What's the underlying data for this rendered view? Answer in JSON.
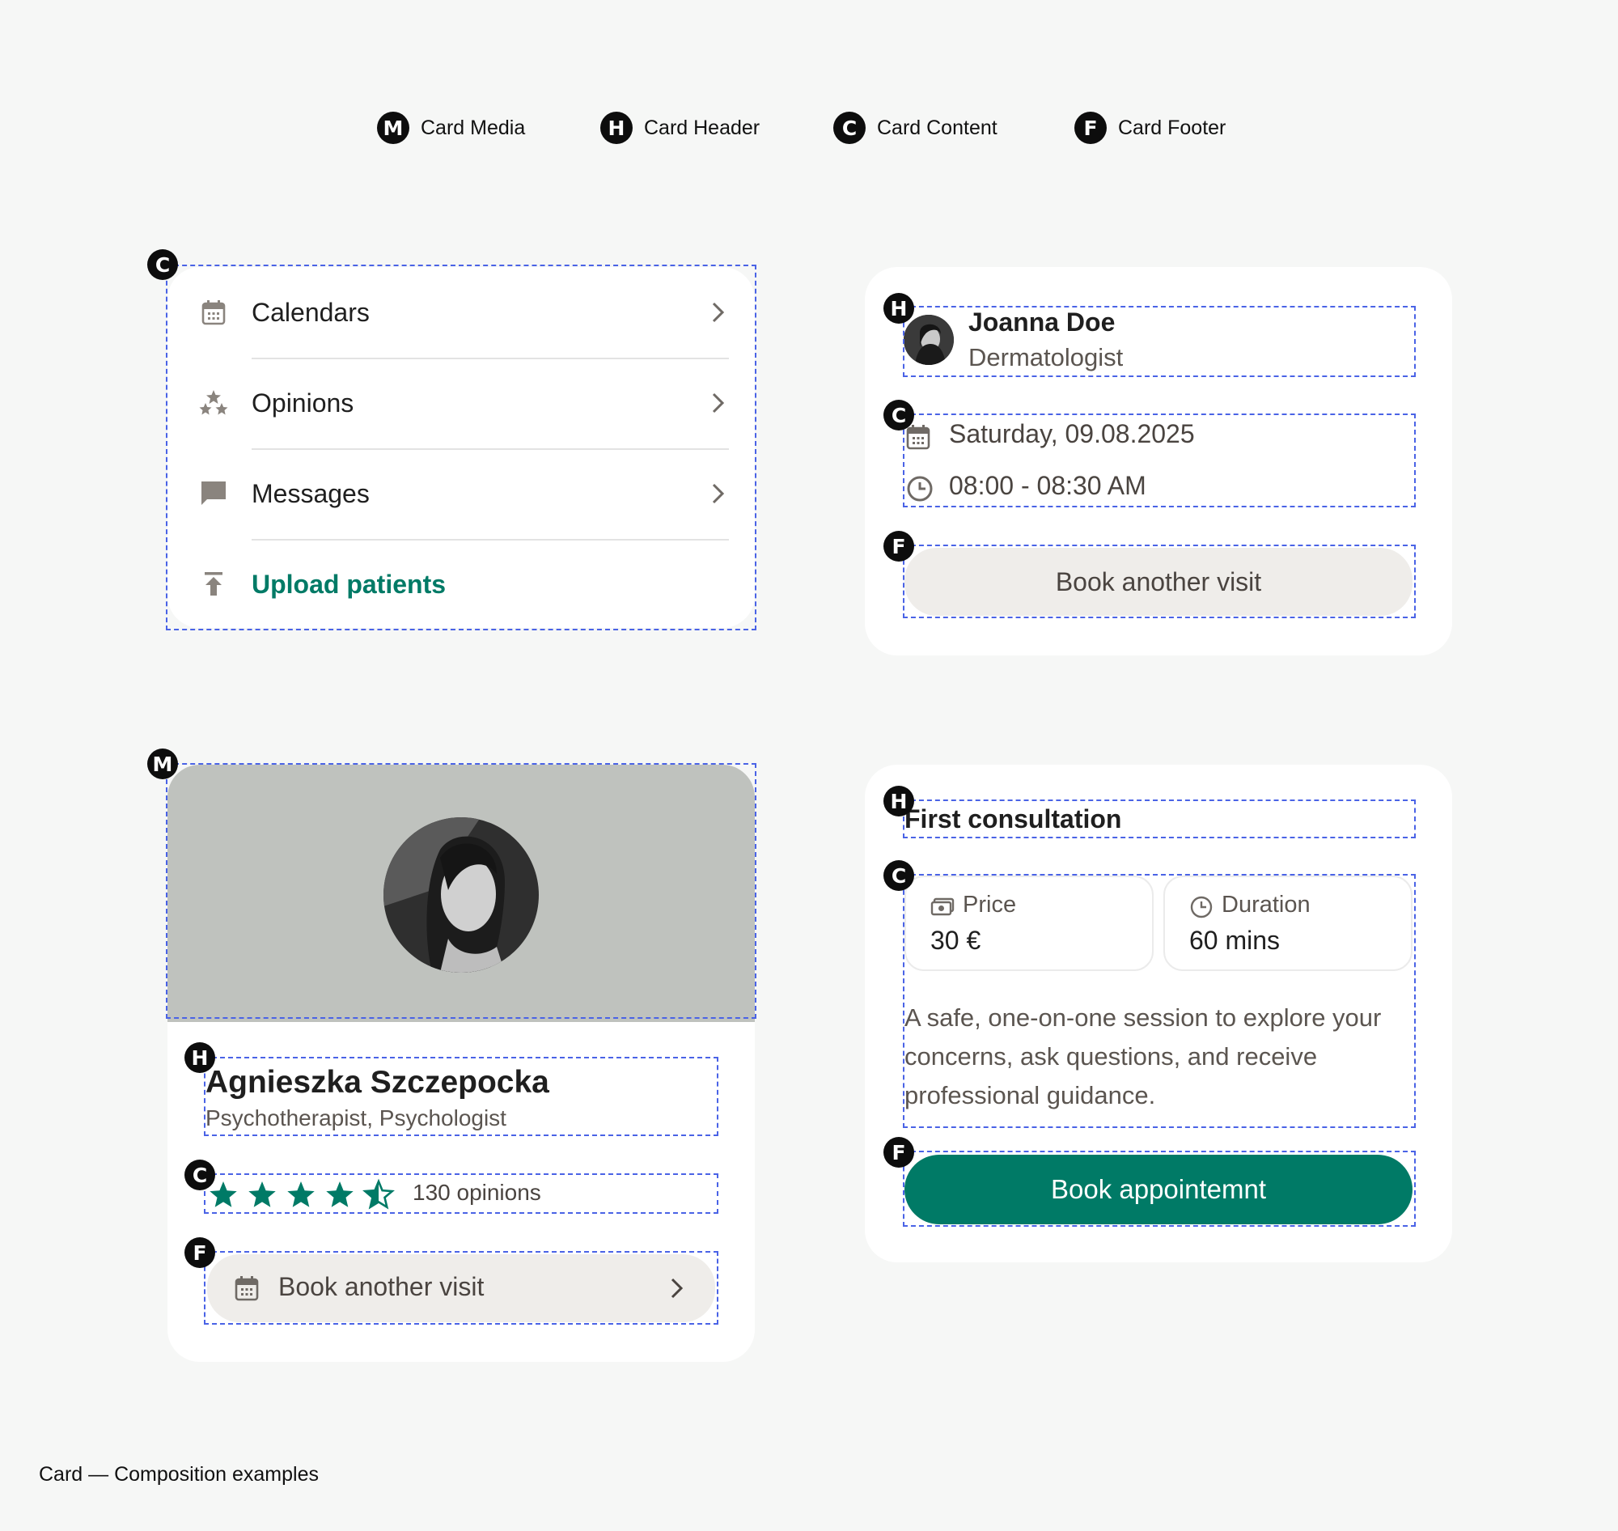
{
  "legend": {
    "items": [
      {
        "badge": "M",
        "label": "Card Media"
      },
      {
        "badge": "H",
        "label": "Card Header"
      },
      {
        "badge": "C",
        "label": "Card Content"
      },
      {
        "badge": "F",
        "label": "Card Footer"
      }
    ]
  },
  "menu_card": {
    "badge": "C",
    "items": [
      {
        "label": "Calendars",
        "icon": "calendar-icon"
      },
      {
        "label": "Opinions",
        "icon": "stars-icon"
      },
      {
        "label": "Messages",
        "icon": "message-icon"
      }
    ],
    "upload": {
      "label": "Upload patients",
      "icon": "upload-icon"
    }
  },
  "appointment_card": {
    "header_badge": "H",
    "name": "Joanna Doe",
    "role": "Dermatologist",
    "content_badge": "C",
    "date": "Saturday, 09.08.2025",
    "time": "08:00 - 08:30 AM",
    "footer_badge": "F",
    "button": "Book another visit"
  },
  "profile_card": {
    "media_badge": "M",
    "header_badge": "H",
    "name": "Agnieszka Szczepocka",
    "role": "Psychotherapist, Psychologist",
    "content_badge": "C",
    "rating": 4.5,
    "opinions": "130 opinions",
    "footer_badge": "F",
    "button": "Book another visit"
  },
  "service_card": {
    "header_badge": "H",
    "title": "First consultation",
    "content_badge": "C",
    "price_label": "Price",
    "price_value": "30 €",
    "duration_label": "Duration",
    "duration_value": "60 mins",
    "description": "A safe, one-on-one session to explore your concerns, ask questions, and receive professional guidance.",
    "footer_badge": "F",
    "button": "Book appointemnt"
  },
  "caption": "Card — Composition examples",
  "colors": {
    "accent": "#007a66",
    "dash": "#4a63e6",
    "neutral_button": "#efedea",
    "media_bg": "#bfc2be"
  }
}
